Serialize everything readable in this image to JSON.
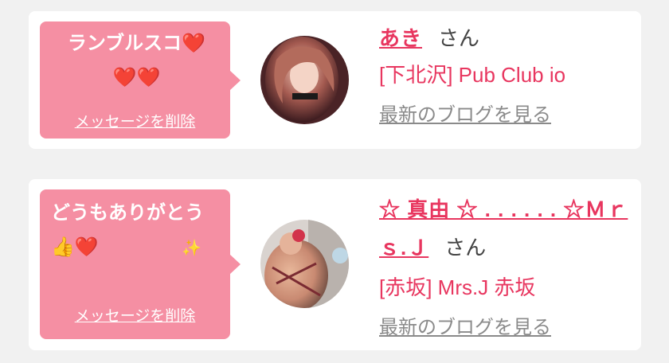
{
  "cards": [
    {
      "message_line1": "ランブルスコ❤️",
      "message_line2": "❤️❤️",
      "delete_label": "メッセージを削除",
      "name": "あき",
      "honorific": "さん",
      "shop": "[下北沢] Pub Club io",
      "blog_label": "最新のブログを見る"
    },
    {
      "message_line1": "どうもありがとう",
      "message_line2": "👍❤️",
      "message_line2_extra": "✨",
      "delete_label": "メッセージを削除",
      "name": "☆ 真由 ☆ . . . . . . ☆Ｍｒｓ.Ｊ",
      "honorific": "さん",
      "shop": "[赤坂] Mrs.J 赤坂",
      "blog_label": "最新のブログを見る"
    }
  ],
  "colors": {
    "background": "#f1f1f1",
    "bubble": "#f58fa3",
    "accent": "#e8365f",
    "link_gray": "#8a8a8a"
  }
}
